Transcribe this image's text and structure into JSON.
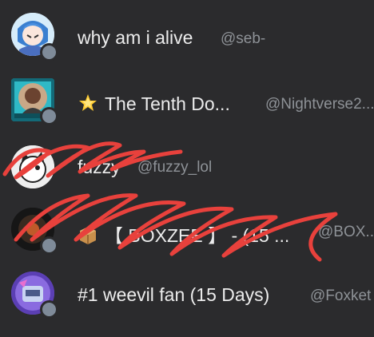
{
  "members": [
    {
      "name": "why am i alive",
      "handle": "@seb-",
      "status_color": "#7f8b99",
      "icon": "anime-avatar"
    },
    {
      "name": "The Tenth Do...",
      "handle": "@Nightverse2...",
      "status_color": "#7f8b99",
      "icon": "star-emoji",
      "avatar_icon": "photo-frame-avatar"
    },
    {
      "name": "fuzzy",
      "handle": "@fuzzy_lol",
      "status_color": "#7f8b99",
      "icon": "cat-avatar"
    },
    {
      "name": "【 BOXZEE 】 - (15 ...",
      "handle": "@BOX...",
      "status_color": "#7f8b99",
      "icon": "package-emoji",
      "avatar_icon": "dark-avatar"
    },
    {
      "name": "#1 weevil fan (15 Days)",
      "handle": "@Foxket",
      "status_color": "#7f8b99",
      "icon": "purple-robot-avatar"
    }
  ],
  "colors": {
    "background": "#2b2b2d",
    "scribble": "#e8413c",
    "name_text": "#ececec",
    "handle_text": "#8e9297"
  }
}
